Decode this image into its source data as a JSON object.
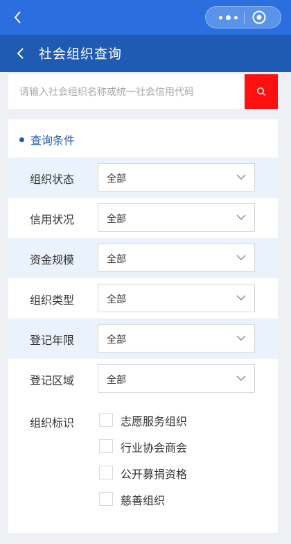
{
  "header": {
    "title": "社会组织查询"
  },
  "search": {
    "placeholder": "请输入社会组织名称或统一社会信用代码"
  },
  "filters": {
    "section_title": "查询条件",
    "rows": [
      {
        "label": "组织状态",
        "value": "全部"
      },
      {
        "label": "信用状况",
        "value": "全部"
      },
      {
        "label": "资金规模",
        "value": "全部"
      },
      {
        "label": "组织类型",
        "value": "全部"
      },
      {
        "label": "登记年限",
        "value": "全部"
      },
      {
        "label": "登记区域",
        "value": "全部"
      }
    ],
    "flags": {
      "label": "组织标识",
      "options": [
        "志愿服务组织",
        "行业协会商会",
        "公开募捐资格",
        "慈善组织"
      ]
    }
  },
  "colors": {
    "topbar": "#2a6ee0",
    "header": "#1f5ab3",
    "search_button": "#ff1010",
    "row_shade": "#eaf2fb"
  }
}
